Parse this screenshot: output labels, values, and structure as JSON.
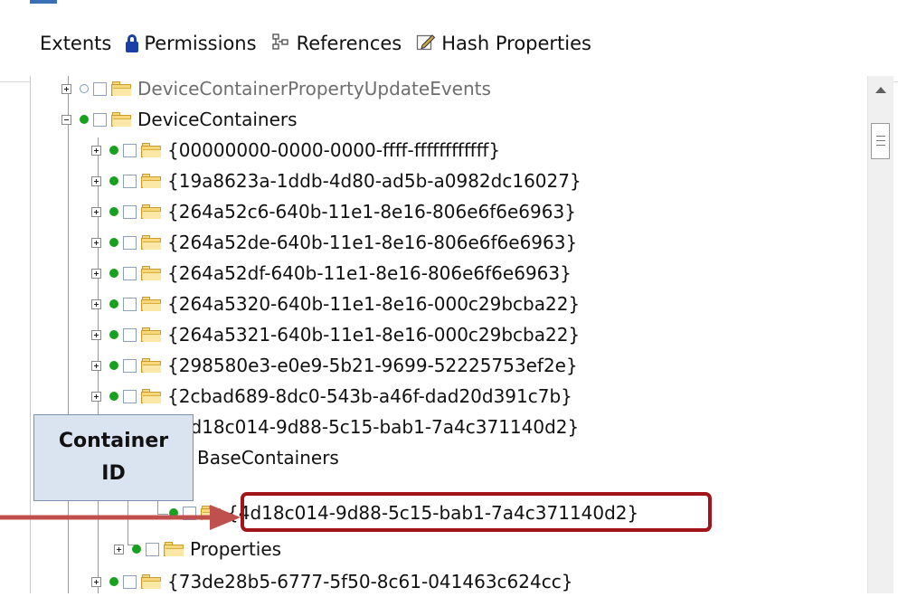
{
  "tabs": [
    {
      "label": "Extents",
      "icon": null
    },
    {
      "label": "Permissions",
      "icon": "lock-icon"
    },
    {
      "label": "References",
      "icon": "references-icon"
    },
    {
      "label": "Hash Properties",
      "icon": "edit-icon"
    }
  ],
  "tree": {
    "rows": [
      {
        "label": "DeviceContainerPropertyUpdateEvents",
        "state": "collapsed",
        "muted": true
      },
      {
        "label": "DeviceContainers",
        "state": "expanded"
      },
      {
        "label": "{00000000-0000-0000-ffff-ffffffffffff}",
        "state": "collapsed"
      },
      {
        "label": "{19a8623a-1ddb-4d80-ad5b-a0982dc16027}",
        "state": "collapsed"
      },
      {
        "label": "{264a52c6-640b-11e1-8e16-806e6f6e6963}",
        "state": "collapsed"
      },
      {
        "label": "{264a52de-640b-11e1-8e16-806e6f6e6963}",
        "state": "collapsed"
      },
      {
        "label": "{264a52df-640b-11e1-8e16-806e6f6e6963}",
        "state": "collapsed"
      },
      {
        "label": "{264a5320-640b-11e1-8e16-000c29bcba22}",
        "state": "collapsed"
      },
      {
        "label": "{264a5321-640b-11e1-8e16-000c29bcba22}",
        "state": "collapsed"
      },
      {
        "label": "{298580e3-e0e9-5b21-9699-52225753ef2e}",
        "state": "collapsed"
      },
      {
        "label": "{2cbad689-8dc0-543b-a46f-dad20d391c7b}",
        "state": "collapsed"
      },
      {
        "label": "{4d18c014-9d88-5c15-bab1-7a4c371140d2}",
        "state": "expanded"
      },
      {
        "label": "BaseContainers",
        "state": "expanded"
      },
      {
        "label": "{4d18c014-9d88-5c15-bab1-7a4c371140d2}",
        "state": "leaf",
        "highlighted": true
      },
      {
        "label": "Properties",
        "state": "collapsed"
      },
      {
        "label": "{73de28b5-6777-5f50-8c61-041463c624cc}",
        "state": "collapsed"
      }
    ]
  },
  "callout": {
    "line1": "Container",
    "line2": "ID"
  },
  "colors": {
    "highlight": "#a3131a",
    "arrow": "#c0504d",
    "callout_bg": "#dae4f1"
  }
}
